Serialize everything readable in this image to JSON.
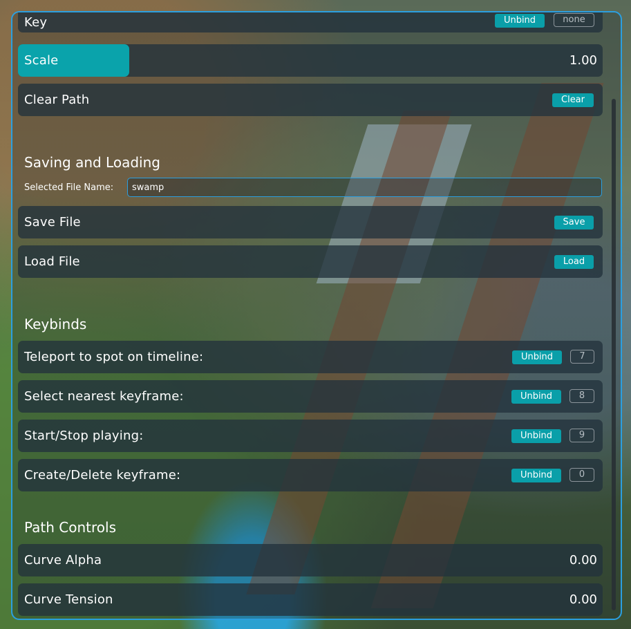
{
  "key_row": {
    "label": "Key",
    "unbind_label": "Unbind",
    "key": "none"
  },
  "scale_row": {
    "label": "Scale",
    "value": "1.00",
    "fill_fraction": 0.19
  },
  "clear_row": {
    "label": "Clear Path",
    "button": "Clear"
  },
  "saving": {
    "title": "Saving and Loading",
    "file_label": "Selected File Name:",
    "file_value": "swamp",
    "save_row": {
      "label": "Save File",
      "button": "Save"
    },
    "load_row": {
      "label": "Load File",
      "button": "Load"
    }
  },
  "keybinds": {
    "title": "Keybinds",
    "items": [
      {
        "label": "Teleport to spot on timeline:",
        "button": "Unbind",
        "key": "7"
      },
      {
        "label": "Select nearest keyframe:",
        "button": "Unbind",
        "key": "8"
      },
      {
        "label": "Start/Stop playing:",
        "button": "Unbind",
        "key": "9"
      },
      {
        "label": "Create/Delete keyframe:",
        "button": "Unbind",
        "key": "0"
      }
    ]
  },
  "path_controls": {
    "title": "Path Controls",
    "items": [
      {
        "label": "Curve Alpha",
        "value": "0.00"
      },
      {
        "label": "Curve Tension",
        "value": "0.00"
      }
    ]
  },
  "colors": {
    "accent": "#0aa3ab",
    "border": "#2b9fe0",
    "row_bg": "#22323c"
  }
}
